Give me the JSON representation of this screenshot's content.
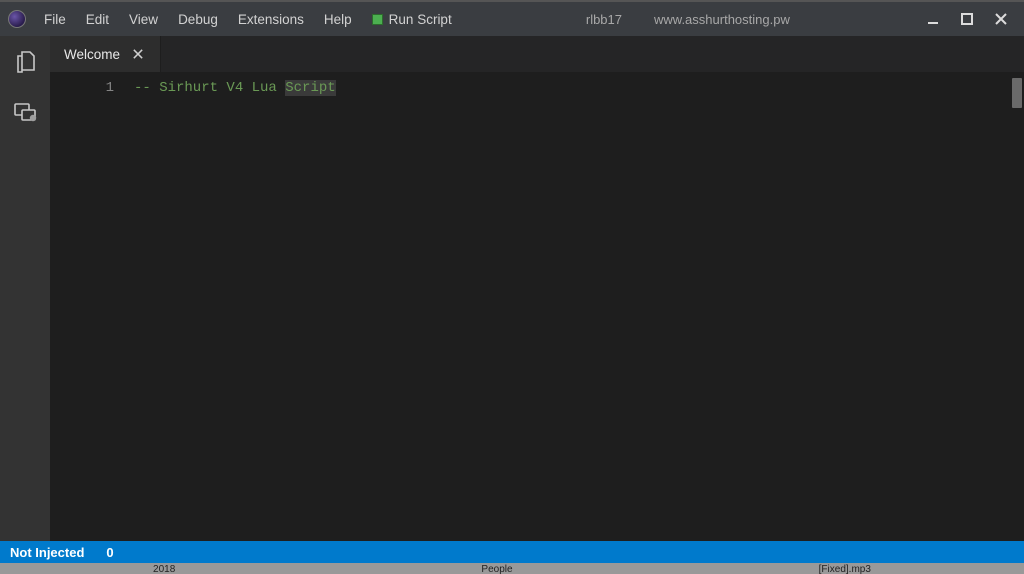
{
  "titlebar": {
    "menu": {
      "file": "File",
      "edit": "Edit",
      "view": "View",
      "debug": "Debug",
      "extensions": "Extensions",
      "help": "Help",
      "run_script": "Run Script"
    },
    "center": {
      "left": "rlbb17",
      "right": "www.asshurthosting.pw"
    }
  },
  "tabs": {
    "welcome": {
      "label": "Welcome"
    }
  },
  "editor": {
    "line_numbers": [
      "1"
    ],
    "line1_prefix": "-- Sirhurt V4 Lua ",
    "line1_highlight": "Script"
  },
  "statusbar": {
    "status": "Not Injected",
    "count": "0"
  },
  "desktop": {
    "a": "2018",
    "b": "People",
    "c": "[Fixed].mp3"
  },
  "colors": {
    "accent": "#007acc",
    "comment": "#6a9955"
  }
}
